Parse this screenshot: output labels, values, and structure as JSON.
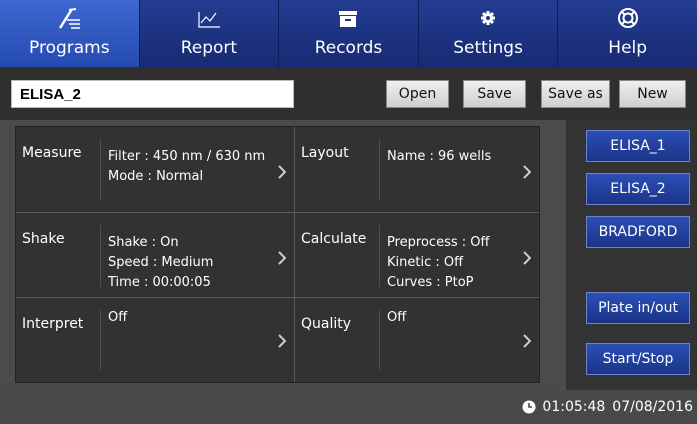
{
  "nav": {
    "tabs": [
      {
        "label": "Programs",
        "icon": "programs-icon",
        "active": true
      },
      {
        "label": "Report",
        "icon": "report-icon",
        "active": false
      },
      {
        "label": "Records",
        "icon": "records-icon",
        "active": false
      },
      {
        "label": "Settings",
        "icon": "settings-icon",
        "active": false
      },
      {
        "label": "Help",
        "icon": "help-icon",
        "active": false
      }
    ]
  },
  "toolbar": {
    "program_name": "ELISA_2",
    "open_label": "Open",
    "save_label": "Save",
    "save_as_label": "Save as",
    "new_label": "New"
  },
  "sections": {
    "measure": {
      "title": "Measure",
      "lines": [
        "Filter :  450 nm / 630 nm",
        "Mode :  Normal"
      ]
    },
    "layout": {
      "title": "Layout",
      "lines": [
        "Name :  96 wells"
      ]
    },
    "shake": {
      "title": "Shake",
      "lines": [
        "Shake : On",
        "Speed : Medium",
        "Time :  00:00:05"
      ]
    },
    "calculate": {
      "title": "Calculate",
      "lines": [
        "Preprocess : Off",
        "Kinetic :  Off",
        "Curves : PtoP"
      ]
    },
    "interpret": {
      "title": "Interpret",
      "lines": [
        "Off"
      ]
    },
    "quality": {
      "title": "Quality",
      "lines": [
        "Off"
      ]
    }
  },
  "side": {
    "programs": [
      "ELISA_1",
      "ELISA_2",
      "BRADFORD"
    ],
    "plate_label": "Plate in/out",
    "start_label": "Start/Stop"
  },
  "status": {
    "time": "01:05:48",
    "date": "07/08/2016"
  },
  "colors": {
    "accent_blue": "#2c4fb6",
    "active_tab": "#3f67d0",
    "tab_blue": "#1e3580"
  }
}
